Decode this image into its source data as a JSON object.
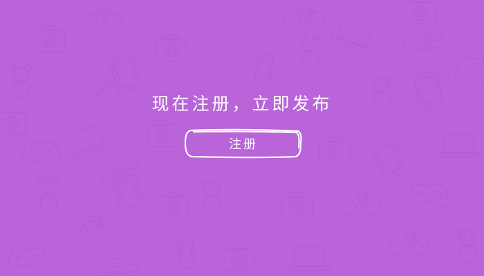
{
  "background_color": "#b964d8",
  "pattern_color": "#a54fc7",
  "pattern_icons": [
    "camera-icon",
    "bicycle-icon",
    "tablet-icon",
    "keyboard-icon",
    "gamepad-icon",
    "teddy-bear-icon",
    "phone-icon",
    "laptop-icon"
  ],
  "headline": "现在注册，立即发布",
  "register_button": {
    "label": "注册"
  }
}
